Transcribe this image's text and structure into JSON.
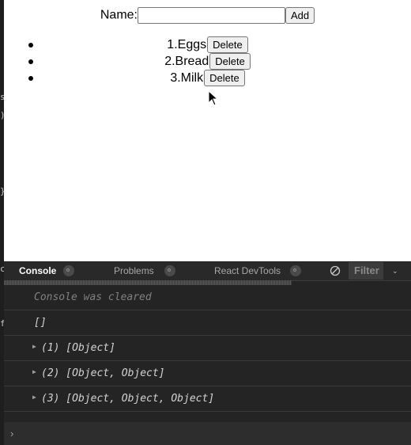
{
  "form": {
    "label": "Name:",
    "name_value": "",
    "add_label": "Add"
  },
  "items": [
    {
      "text": "1.Eggs",
      "delete_label": "Delete"
    },
    {
      "text": "2.Bread",
      "delete_label": "Delete"
    },
    {
      "text": "3.Milk",
      "delete_label": "Delete"
    }
  ],
  "devtools": {
    "tabs": {
      "console": "Console",
      "problems": "Problems",
      "react": "React DevTools"
    },
    "filter_label": "Filter",
    "logs": [
      {
        "text": "Console was cleared"
      },
      {
        "text": "[]"
      },
      {
        "text": "(1) [Object]"
      },
      {
        "text": "(2) [Object, Object]"
      },
      {
        "text": "(3) [Object, Object, Object]"
      }
    ],
    "prompt_symbol": "›"
  },
  "edge_chars": [
    "s",
    ")",
    "}",
    "c",
    "f"
  ],
  "colors": {
    "page_bg": "#ffffff",
    "devtools_bg": "#242424",
    "tab_bar": "#292929",
    "muted_text": "#808080"
  },
  "icons": [
    "mouse-cursor-icon",
    "clear-console-icon",
    "chevron-down-icon",
    "expand-arrow-icon"
  ]
}
